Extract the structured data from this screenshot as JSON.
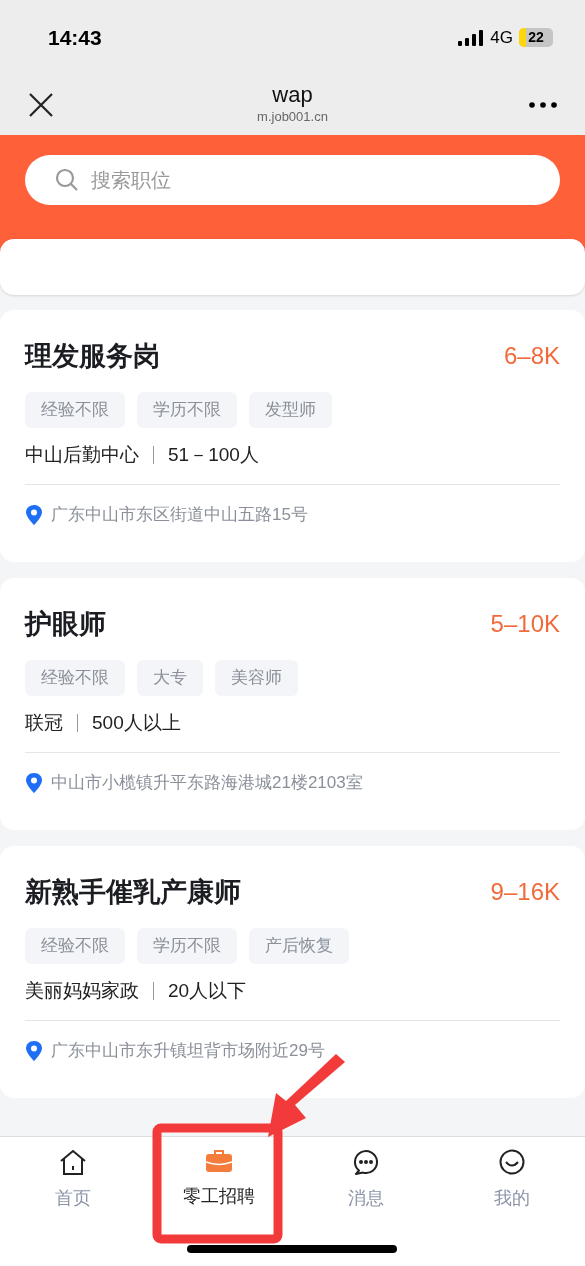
{
  "status_bar": {
    "time": "14:43",
    "network": "4G",
    "battery": "22"
  },
  "nav_bar": {
    "title": "wap",
    "subtitle": "m.job001.cn"
  },
  "search": {
    "placeholder": "搜索职位"
  },
  "jobs": [
    {
      "title": "理发服务岗",
      "salary": "6–8K",
      "tags": [
        "经验不限",
        "学历不限",
        "发型师"
      ],
      "company": "中山后勤中心",
      "size": "51－100人",
      "address": "广东中山市东区街道中山五路15号"
    },
    {
      "title": "护眼师",
      "salary": "5–10K",
      "tags": [
        "经验不限",
        "大专",
        "美容师"
      ],
      "company": "联冠",
      "size": "500人以上",
      "address": "中山市小榄镇升平东路海港城21楼2103室"
    },
    {
      "title": "新熟手催乳产康师",
      "salary": "9–16K",
      "tags": [
        "经验不限",
        "学历不限",
        "产后恢复"
      ],
      "company": "美丽妈妈家政",
      "size": "20人以下",
      "address": "广东中山市东升镇坦背市场附近29号"
    }
  ],
  "tab_bar": [
    {
      "kind": "home",
      "label": "首页",
      "selected": false
    },
    {
      "kind": "jobs",
      "label": "零工招聘",
      "selected": true
    },
    {
      "kind": "messages",
      "label": "消息",
      "selected": false
    },
    {
      "kind": "profile",
      "label": "我的",
      "selected": false
    }
  ]
}
